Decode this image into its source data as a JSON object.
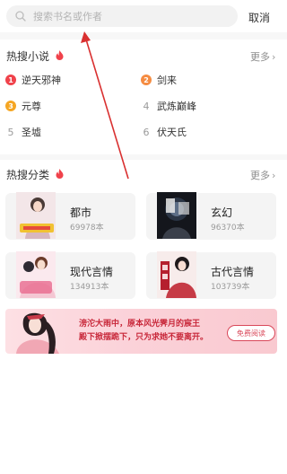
{
  "search": {
    "placeholder": "搜索书名或作者",
    "value": "",
    "cancel_label": "取消"
  },
  "hot_search": {
    "title": "热搜小说",
    "more_label": "更多",
    "items": [
      {
        "rank": "1",
        "title": "逆天邪神",
        "badge_color": "#f0424b"
      },
      {
        "rank": "2",
        "title": "剑来",
        "badge_color": "#f58c42"
      },
      {
        "rank": "3",
        "title": "元尊",
        "badge_color": "#f5a623"
      },
      {
        "rank": "4",
        "title": "武炼巅峰"
      },
      {
        "rank": "5",
        "title": "圣墟"
      },
      {
        "rank": "6",
        "title": "伏天氏"
      }
    ]
  },
  "hot_categories": {
    "title": "热搜分类",
    "more_label": "更多",
    "items": [
      {
        "name": "都市",
        "count": "69978本"
      },
      {
        "name": "玄幻",
        "count": "96370本"
      },
      {
        "name": "现代言情",
        "count": "134913本"
      },
      {
        "name": "古代言情",
        "count": "103739本"
      }
    ]
  },
  "banner": {
    "line1": "滂沱大雨中，原本风光霁月的宸王",
    "line2": "殿下掀摆跪下，只为求她不要离开。",
    "button_label": "免费阅读"
  },
  "colors": {
    "accent": "#f0424b",
    "annotation_arrow": "#d93030"
  }
}
